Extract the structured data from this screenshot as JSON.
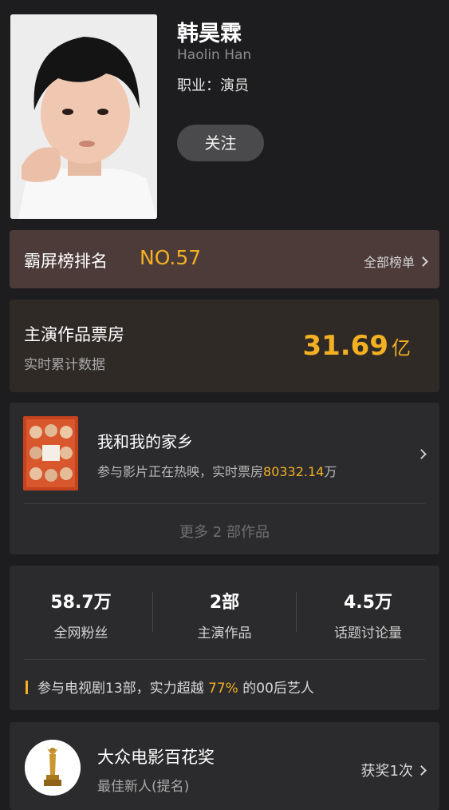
{
  "profile": {
    "name": "韩昊霖",
    "english_name": "Haolin Han",
    "occupation": "职业：演员",
    "follow_label": "关注"
  },
  "ranking": {
    "label": "霸屏榜排名",
    "value": "NO.57",
    "link_label": "全部榜单"
  },
  "box_office": {
    "title": "主演作品票房",
    "subtitle": "实时累计数据",
    "amount": "31.69",
    "unit": "亿"
  },
  "works": {
    "movie_title": "我和我的家乡",
    "desc_prefix": "参与影片正在热映，实时票房",
    "desc_amount": "80332.14",
    "desc_unit": "万",
    "more_label": "更多 2 部作品"
  },
  "stats": {
    "items": [
      {
        "value": "58.7万",
        "label": "全网粉丝"
      },
      {
        "value": "2部",
        "label": "主演作品"
      },
      {
        "value": "4.5万",
        "label": "话题讨论量"
      }
    ],
    "note_prefix": "参与电视剧13部，实力超越 ",
    "note_percent": "77%",
    "note_suffix": " 的00后艺人"
  },
  "award": {
    "title": "大众电影百花奖",
    "subtitle": "最佳新人(提名)",
    "count_label": "获奖1次"
  },
  "colors": {
    "background": "#1d1d1f",
    "accent": "#f2b022",
    "ranking_bg": "#4c3b38",
    "card_bg": "#2b2b2d"
  }
}
